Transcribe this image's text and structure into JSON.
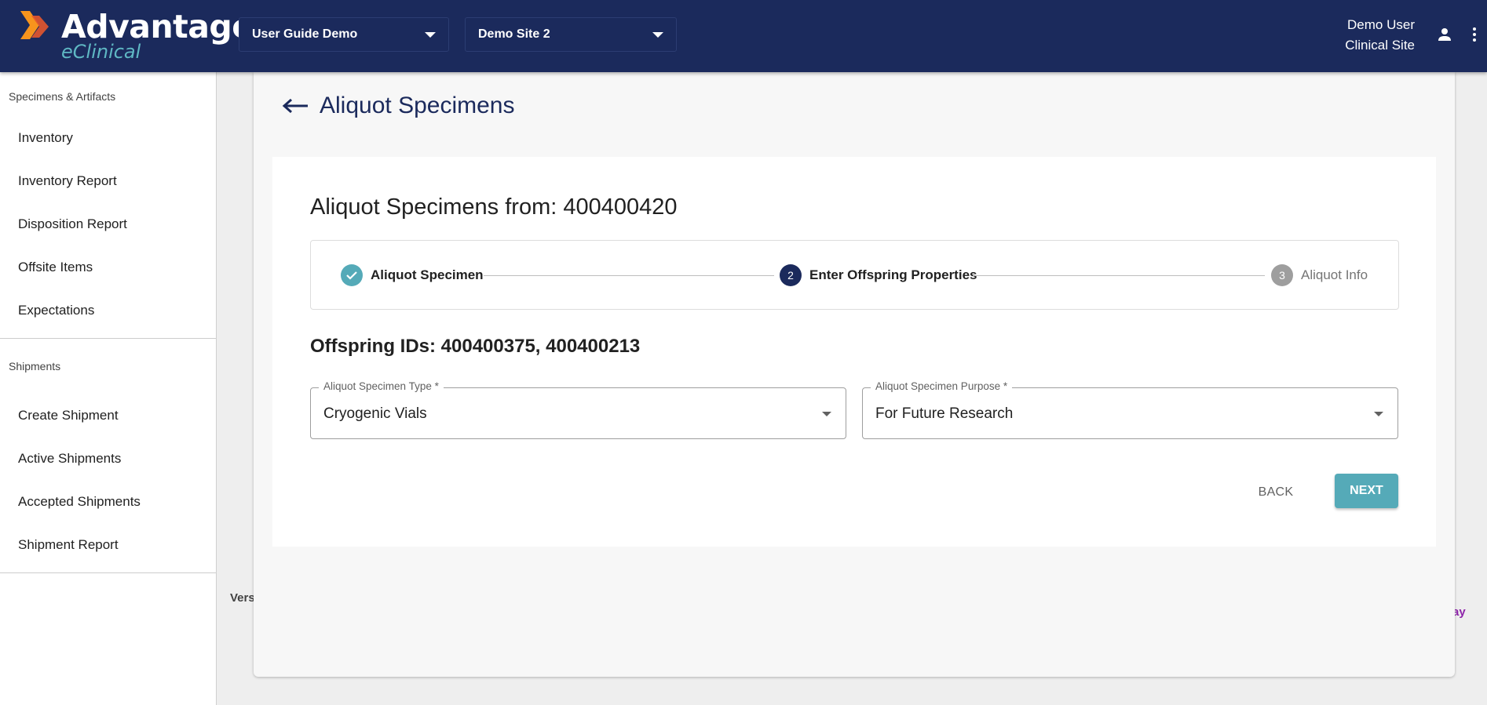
{
  "header": {
    "logo_title": "Advantage",
    "logo_subtitle": "eClinical",
    "study_select": "User Guide Demo",
    "site_select": "Demo Site 2",
    "user_name": "Demo User",
    "user_role": "Clinical Site",
    "icons": [
      "user-icon",
      "more-vert-icon",
      "chevron-down-icon"
    ]
  },
  "sidebar": {
    "sections": [
      {
        "heading": "Specimens & Artifacts",
        "items": [
          {
            "label": "Inventory"
          },
          {
            "label": "Inventory Report"
          },
          {
            "label": "Disposition Report"
          },
          {
            "label": "Offsite Items"
          },
          {
            "label": "Expectations"
          }
        ]
      },
      {
        "heading": "Shipments",
        "items": [
          {
            "label": "Create Shipment"
          },
          {
            "label": "Active Shipments"
          },
          {
            "label": "Accepted Shipments"
          },
          {
            "label": "Shipment Report"
          }
        ]
      }
    ]
  },
  "main": {
    "page_title": "Aliquot Specimens",
    "content_title": "Aliquot Specimens from: 400400420",
    "steps": [
      {
        "number": "✓",
        "label": "Aliquot Specimen",
        "state": "complete"
      },
      {
        "number": "2",
        "label": "Enter Offspring Properties",
        "state": "active"
      },
      {
        "number": "3",
        "label": "Aliquot Info",
        "state": "pending"
      }
    ],
    "offspring_ids": "Offspring IDs: 400400375, 400400213",
    "fields": {
      "type_label": "Aliquot Specimen Type *",
      "type_value": "Cryogenic Vials",
      "purpose_label": "Aliquot Specimen Purpose *",
      "purpose_value": "For Future Research"
    },
    "back_label": "BACK",
    "next_label": "NEXT"
  },
  "footer": {
    "version_fragment": "Vers",
    "link_fragment": "ay"
  },
  "colors": {
    "navy": "#1b2a5c",
    "teal": "#55aab8",
    "logo_orange": "#f7941d",
    "logo_red": "#e4572e"
  }
}
